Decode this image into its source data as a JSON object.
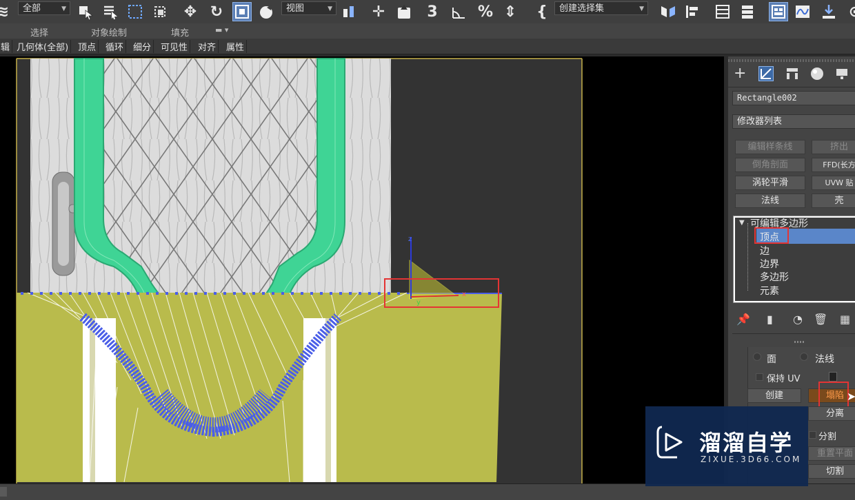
{
  "toolbar": {
    "selection_filter": "全部",
    "coord_system": "视图",
    "snap_labels": [
      "3",
      "%"
    ],
    "named_selection_placeholder": "创建选择集"
  },
  "ribbon": {
    "groups": [
      "选择",
      "对象绘制",
      "填充"
    ],
    "tabs": [
      "辑",
      "几何体(全部)",
      "顶点",
      "循环",
      "细分",
      "可见性",
      "对齐",
      "属性"
    ]
  },
  "viewport": {
    "gizmo_axes": [
      "z",
      "x",
      "y"
    ],
    "colors": {
      "door": "#d9d9d9",
      "frame": "#3fd495",
      "plane": "#b9bb4c",
      "vertex": "#4a5ee8",
      "highlight": "#e43434"
    }
  },
  "panel": {
    "object_name": "Rectangle002",
    "modifier_list": "修改器列表",
    "modifier_buttons": [
      [
        "编辑样条线",
        "挤出"
      ],
      [
        "倒角剖面",
        "FFD(长方"
      ],
      [
        "涡轮平滑",
        "UVW 贴"
      ],
      [
        "法线",
        "壳"
      ]
    ],
    "stack_root": "可编辑多边形",
    "stack_items": [
      "顶点",
      "边",
      "边界",
      "多边形",
      "元素"
    ],
    "sub_options": {
      "face": "面",
      "normal": "法线",
      "preserve_uv": "保持 UV"
    },
    "buttons": {
      "create": "创建",
      "collapse": "塌陷",
      "detach": "分离",
      "split": "分割",
      "reset_plane": "重置平面",
      "cut": "切割"
    }
  },
  "watermark": {
    "brand": "溜溜自学",
    "url": "ZIXUE.3D66.COM"
  }
}
